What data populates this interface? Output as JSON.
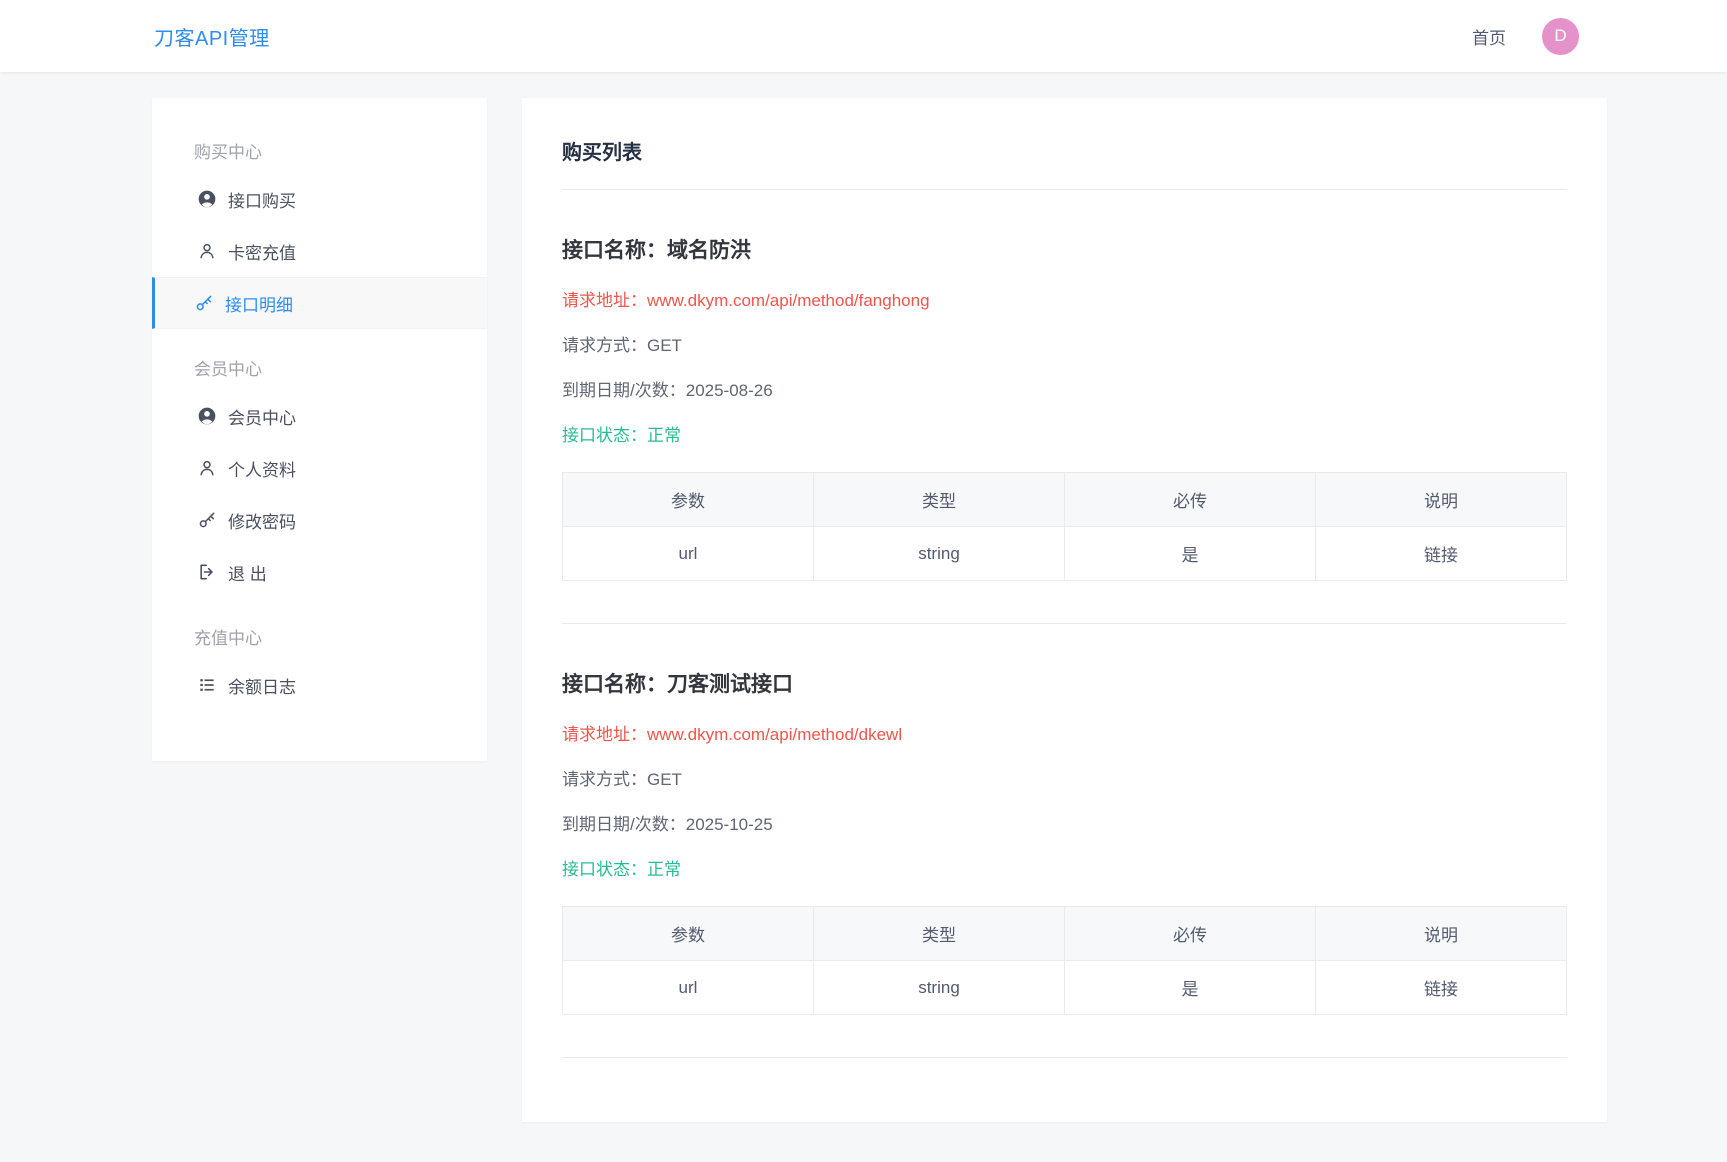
{
  "header": {
    "brand": "刀客API管理",
    "nav_home": "首页",
    "avatar_letter": "D"
  },
  "sidebar": {
    "sections": [
      {
        "title": "购买中心",
        "items": [
          {
            "label": "接口购买",
            "icon": "user-circle-icon",
            "active": false
          },
          {
            "label": "卡密充值",
            "icon": "user-outline-icon",
            "active": false
          },
          {
            "label": "接口明细",
            "icon": "key-icon",
            "active": true
          }
        ]
      },
      {
        "title": "会员中心",
        "items": [
          {
            "label": "会员中心",
            "icon": "user-circle-icon",
            "active": false
          },
          {
            "label": "个人资料",
            "icon": "user-outline-icon",
            "active": false
          },
          {
            "label": "修改密码",
            "icon": "key-icon",
            "active": false
          },
          {
            "label": "退 出",
            "icon": "sign-out-icon",
            "active": false
          }
        ]
      },
      {
        "title": "充值中心",
        "items": [
          {
            "label": "余额日志",
            "icon": "list-icon",
            "active": false
          }
        ]
      }
    ]
  },
  "main": {
    "title": "购买列表",
    "labels": {
      "name": "接口名称：",
      "url": "请求地址：",
      "method": "请求方式：",
      "expire": "到期日期/次数：",
      "status": "接口状态："
    },
    "apis": [
      {
        "name": "域名防洪",
        "url": "www.dkym.com/api/method/fanghong",
        "method": "GET",
        "expire": "2025-08-26",
        "status": "正常",
        "table": {
          "headers": [
            "参数",
            "类型",
            "必传",
            "说明"
          ],
          "rows": [
            [
              "url",
              "string",
              "是",
              "链接"
            ]
          ]
        }
      },
      {
        "name": "刀客测试接口",
        "url": "www.dkym.com/api/method/dkewl",
        "method": "GET",
        "expire": "2025-10-25",
        "status": "正常",
        "table": {
          "headers": [
            "参数",
            "类型",
            "必传",
            "说明"
          ],
          "rows": [
            [
              "url",
              "string",
              "是",
              "链接"
            ]
          ]
        }
      }
    ]
  },
  "colors": {
    "brand_blue": "#2d8cf0",
    "danger_red": "#f0554b",
    "success_green": "#26bd94",
    "avatar_pink": "#e592cb"
  }
}
